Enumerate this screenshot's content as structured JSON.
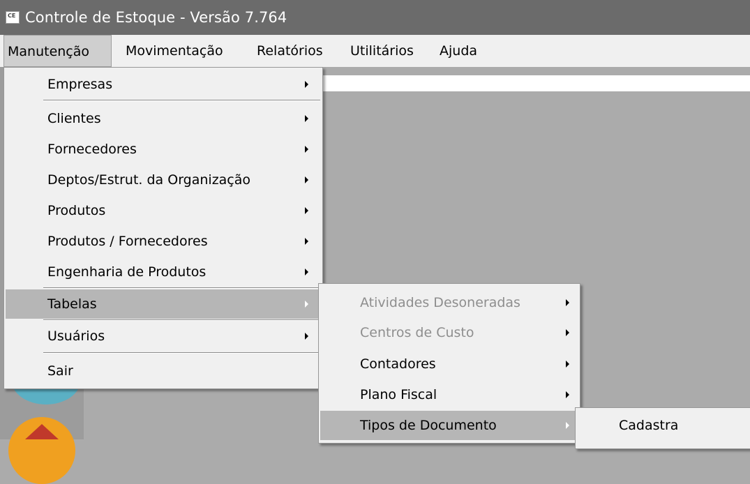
{
  "window": {
    "icon_text": "CE",
    "title": "Controle de Estoque - Versão 7.764"
  },
  "menubar": {
    "items": [
      "Manutenção",
      "Movimentação",
      "Relatórios",
      "Utilitários",
      "Ajuda"
    ]
  },
  "manutencao_menu": {
    "items": [
      {
        "label": "Empresas",
        "submenu": true
      },
      {
        "label": "Clientes",
        "submenu": true
      },
      {
        "label": "Fornecedores",
        "submenu": true
      },
      {
        "label": "Deptos/Estrut. da Organização",
        "submenu": true
      },
      {
        "label": "Produtos",
        "submenu": true
      },
      {
        "label": "Produtos / Fornecedores",
        "submenu": true
      },
      {
        "label": "Engenharia de Produtos",
        "submenu": true
      },
      {
        "label": "Tabelas",
        "submenu": true,
        "highlighted": true
      },
      {
        "label": "Usuários",
        "submenu": true
      },
      {
        "label": "Sair",
        "submenu": false
      }
    ]
  },
  "tabelas_menu": {
    "items": [
      {
        "label": "Atividades Desoneradas",
        "submenu": true,
        "disabled": true
      },
      {
        "label": "Centros de Custo",
        "submenu": true,
        "disabled": true
      },
      {
        "label": "Contadores",
        "submenu": true
      },
      {
        "label": "Plano Fiscal",
        "submenu": true
      },
      {
        "label": "Tipos de Documento",
        "submenu": true,
        "highlighted": true
      }
    ]
  },
  "tipos_documento_menu": {
    "items": [
      {
        "label": "Cadastra"
      }
    ]
  },
  "colors": {
    "titlebar": "#6b6b6b",
    "menu_background": "#f0f0f0",
    "highlight": "#b6b6b6",
    "disabled_text": "#8e8e8e"
  }
}
